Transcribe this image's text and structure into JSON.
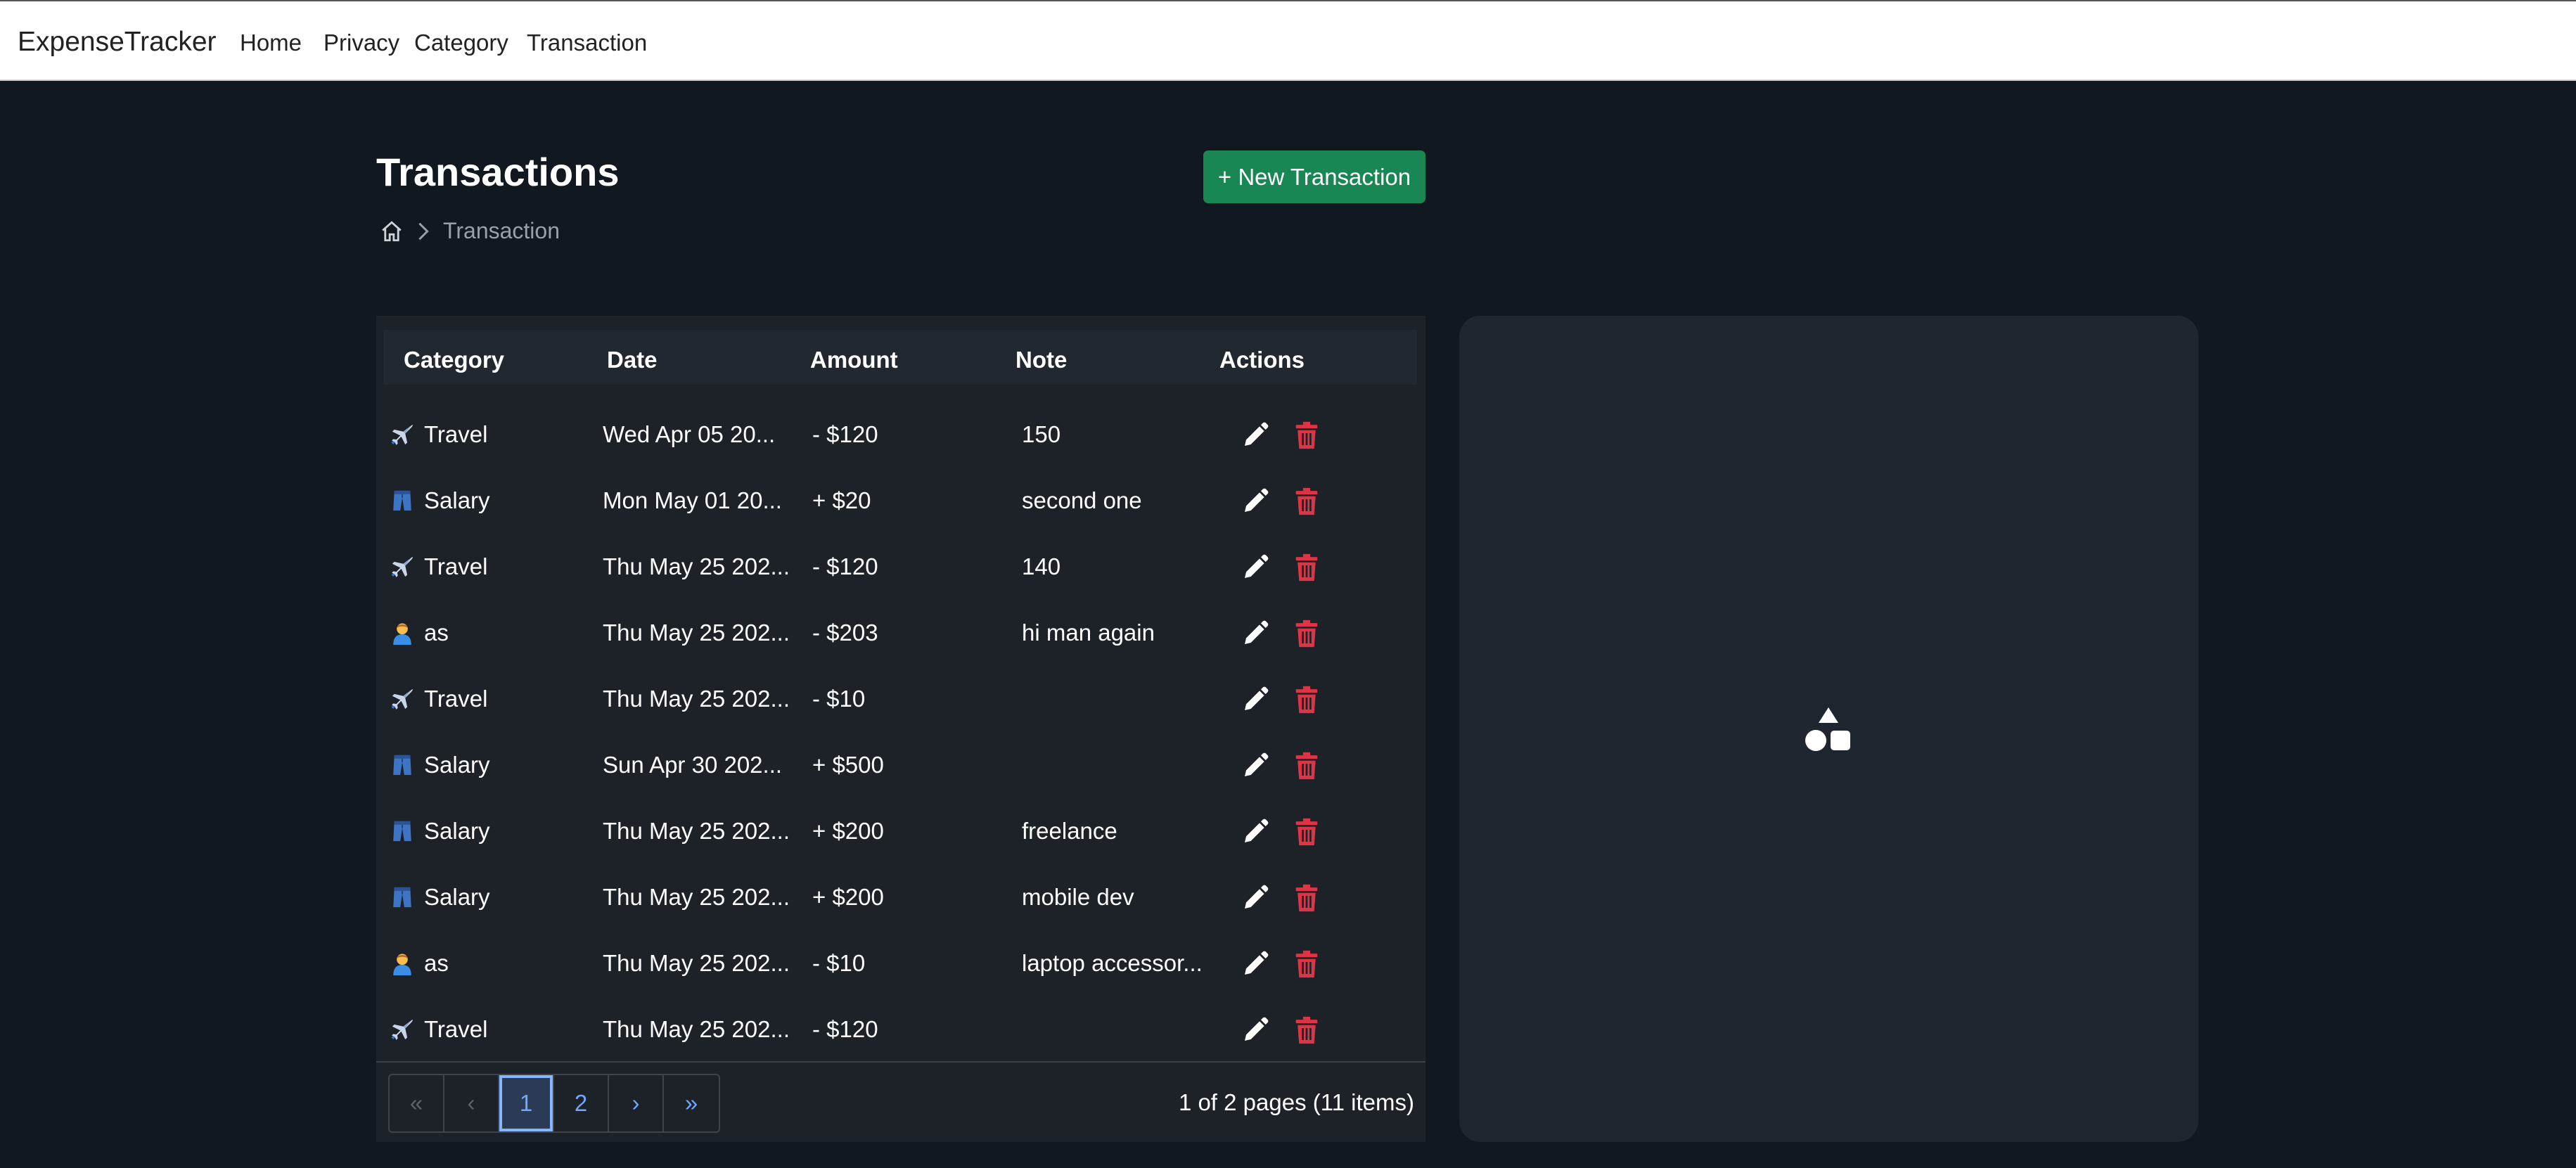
{
  "nav": {
    "brand": "ExpenseTracker",
    "links": [
      "Home",
      "Privacy",
      "Category",
      "Transaction"
    ]
  },
  "header": {
    "title": "Transactions",
    "new_button": "+ New Transaction",
    "breadcrumb": {
      "home_icon": "home-icon",
      "current": "Transaction"
    }
  },
  "table": {
    "columns": [
      "Category",
      "Date",
      "Amount",
      "Note",
      "Actions"
    ],
    "rows": [
      {
        "icon": "airplane-icon",
        "category": "Travel",
        "date": "Wed Apr 05 20...",
        "amount": "- $120",
        "note": "150"
      },
      {
        "icon": "jeans-icon",
        "category": "Salary",
        "date": "Mon May 01 20...",
        "amount": "+ $20",
        "note": "second one"
      },
      {
        "icon": "airplane-icon",
        "category": "Travel",
        "date": "Thu May 25 202...",
        "amount": "- $120",
        "note": "140"
      },
      {
        "icon": "person-icon",
        "category": "as",
        "date": "Thu May 25 202...",
        "amount": "- $203",
        "note": "hi man again"
      },
      {
        "icon": "airplane-icon",
        "category": "Travel",
        "date": "Thu May 25 202...",
        "amount": "- $10",
        "note": ""
      },
      {
        "icon": "jeans-icon",
        "category": "Salary",
        "date": "Sun Apr 30 202...",
        "amount": "+ $500",
        "note": ""
      },
      {
        "icon": "jeans-icon",
        "category": "Salary",
        "date": "Thu May 25 202...",
        "amount": "+ $200",
        "note": "freelance"
      },
      {
        "icon": "jeans-icon",
        "category": "Salary",
        "date": "Thu May 25 202...",
        "amount": "+ $200",
        "note": "mobile dev"
      },
      {
        "icon": "person-icon",
        "category": "as",
        "date": "Thu May 25 202...",
        "amount": "- $10",
        "note": "laptop accessor..."
      },
      {
        "icon": "airplane-icon",
        "category": "Travel",
        "date": "Thu May 25 202...",
        "amount": "- $120",
        "note": ""
      }
    ],
    "row_actions": {
      "edit_icon": "pencil-icon",
      "delete_icon": "trash-icon"
    }
  },
  "pager": {
    "first": "«",
    "prev": "‹",
    "pages": [
      "1",
      "2"
    ],
    "active_page": "1",
    "next": "›",
    "last": "»",
    "info": "1 of 2 pages (11 items)"
  },
  "chart_panel": {
    "placeholder_icon": "shapes-icon"
  },
  "colors": {
    "background": "#111820",
    "panel": "#1d2228",
    "primary_button": "#198754",
    "delete": "#dc3545",
    "link": "#6ea8fe"
  }
}
